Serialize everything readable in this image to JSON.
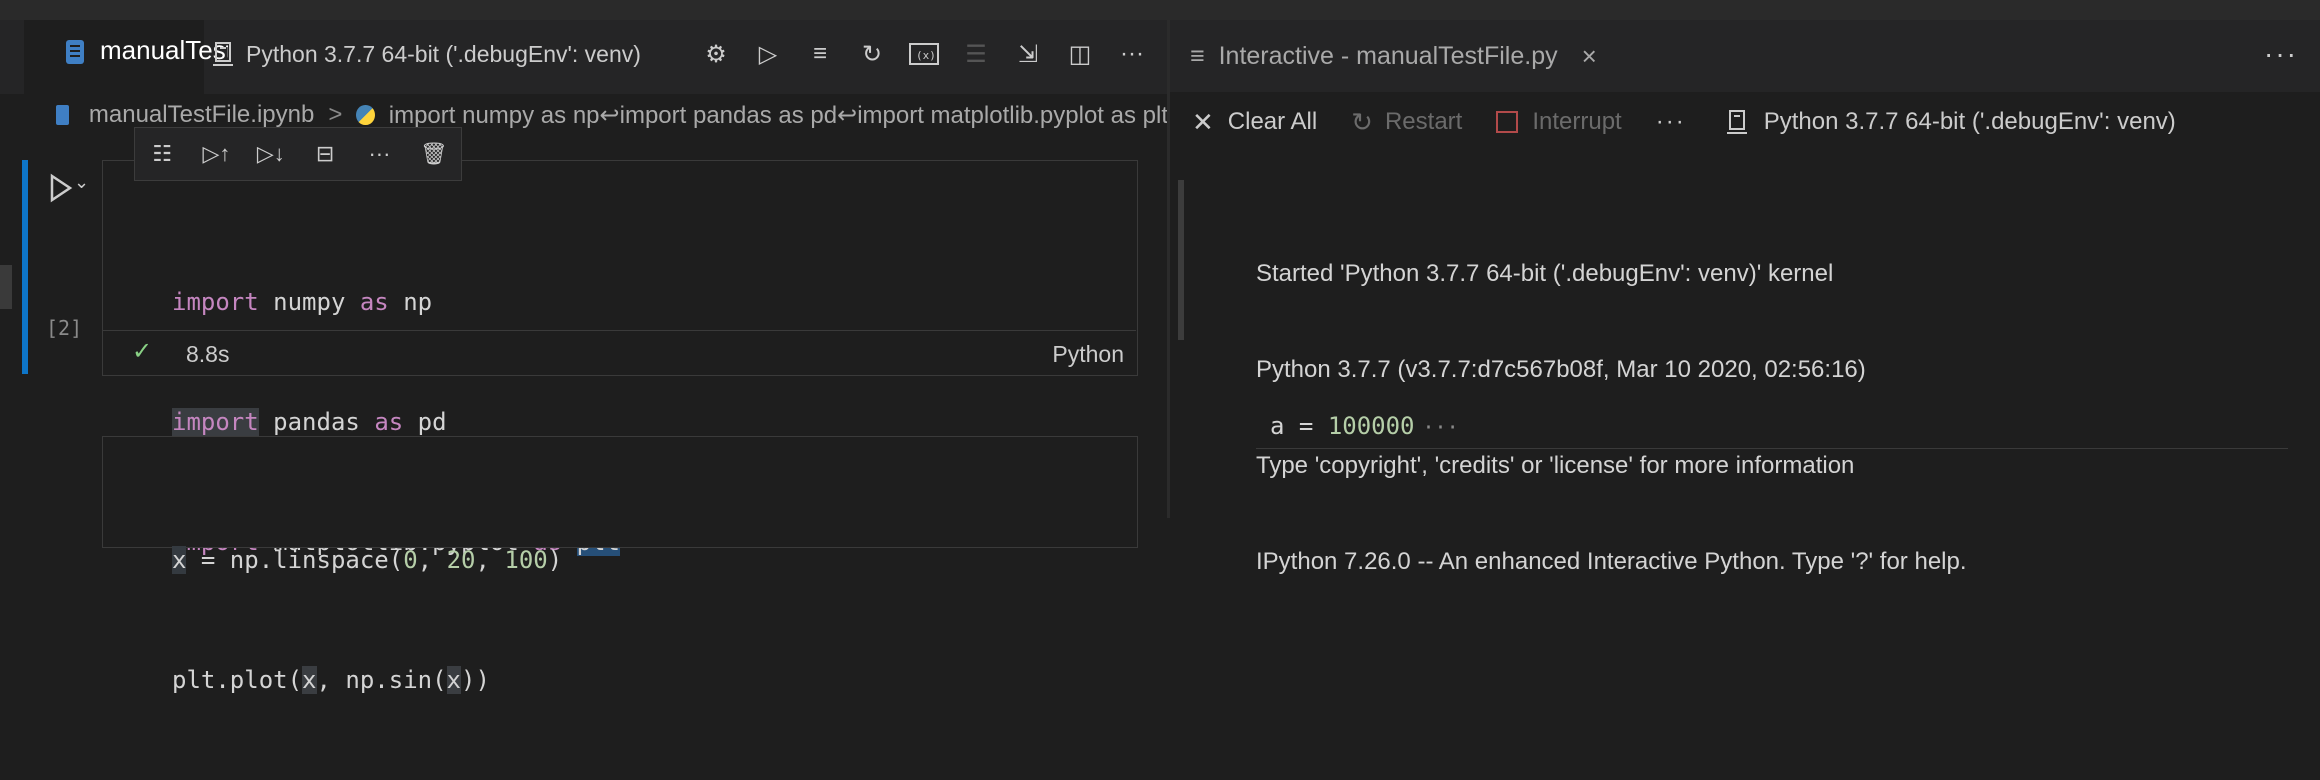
{
  "left_editor": {
    "tab": {
      "title": "manualTestFile.ipynb"
    },
    "kernel_label": "Python 3.7.7 64-bit ('.debugEnv': venv)",
    "toolbar_icons": [
      "gear-icon",
      "run-all-icon",
      "clear-outputs-icon",
      "restart-icon",
      "variables-icon",
      "outline-icon",
      "export-icon",
      "split-editor-icon",
      "more-icon"
    ],
    "breadcrumb": {
      "file": "manualTestFile.ipynb",
      "separator": ">",
      "cell": "import numpy as np↩import pandas as pd↩import matplotlib.pyplot as plt"
    },
    "cell_toolbar": {
      "icons": [
        "run-by-line-icon",
        "execute-above-icon",
        "execute-below-icon",
        "split-cell-icon",
        "more-icon",
        "delete-icon"
      ],
      "more_label": "···"
    },
    "cells": [
      {
        "execution_count": "[2]",
        "lines": [
          {
            "kw": "import",
            "a": "numpy",
            "kw2": "as",
            "b": "np"
          },
          {
            "kw": "import",
            "a": "pandas",
            "kw2": "as",
            "b": "pd"
          },
          {
            "kw": "import",
            "a": "matplotlib.pyplot",
            "kw2": "as",
            "b": "plt"
          }
        ],
        "status": {
          "duration": "8.8s",
          "language": "Python"
        }
      },
      {
        "line1": {
          "var": "x",
          "rest1": " = np.linspace(",
          "n1": "0",
          "c1": ", ",
          "n2": "20",
          "c2": ", ",
          "n3": "100",
          "end": ")"
        },
        "line2": {
          "pre": "plt.plot(",
          "v1": "x",
          "mid": ", np.sin(",
          "v2": "x",
          "end": "))"
        }
      }
    ]
  },
  "interactive": {
    "tab_title": "Interactive - manualTestFile.py",
    "tab_close": "×",
    "more_label": "···",
    "toolbar": {
      "clear_all": "Clear All",
      "restart": "Restart",
      "interrupt": "Interrupt",
      "more": "···",
      "kernel": "Python 3.7.7 64-bit ('.debugEnv': venv)"
    },
    "output_lines": [
      "Started 'Python 3.7.7 64-bit ('.debugEnv': venv)' kernel",
      "Python 3.7.7 (v3.7.7:d7c567b08f, Mar 10 2020, 02:56:16)",
      "Type 'copyright', 'credits' or 'license' for more information",
      "IPython 7.26.0 -- An enhanced Interactive Python. Type '?' for help."
    ],
    "cell": {
      "var": "a",
      "op": " = ",
      "value": "100000",
      "more": "···"
    }
  },
  "colors": {
    "accent": "#0e75c8",
    "keyword": "#c586c0",
    "number": "#b5cea8",
    "success": "#89d185",
    "stop": "#b24a4a"
  }
}
